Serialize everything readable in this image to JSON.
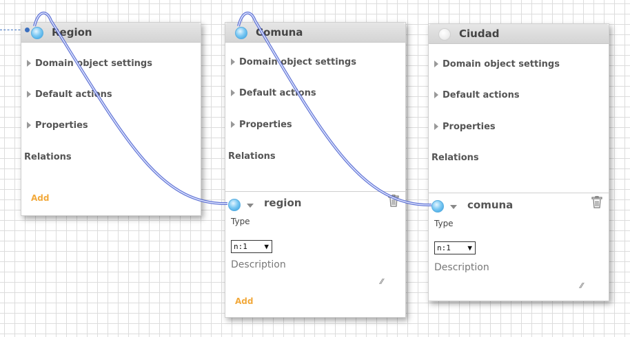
{
  "entities": [
    {
      "title": "Region",
      "sections": [
        "Domain object settings",
        "Default actions",
        "Properties"
      ],
      "relations_label": "Relations",
      "add_label": "Add",
      "relation": null
    },
    {
      "title": "Comuna",
      "sections": [
        "Domain object settings",
        "Default actions",
        "Properties"
      ],
      "relations_label": "Relations",
      "relation": {
        "name": "region",
        "type_label": "Type",
        "type_value": "n:1",
        "description_placeholder": "Description",
        "add_label": "Add"
      }
    },
    {
      "title": "Ciudad",
      "sections": [
        "Domain object settings",
        "Default actions",
        "Properties"
      ],
      "relations_label": "Relations",
      "relation": {
        "name": "comuna",
        "type_label": "Type",
        "type_value": "n:1",
        "description_placeholder": "Description"
      }
    }
  ],
  "colors": {
    "grid": "#dcdcdc",
    "connector": "#4a5fcf",
    "add_link": "#f2a93b",
    "orb_active": "#2f9ee0"
  },
  "icons": {
    "relation_connector": "blue-orb-icon",
    "delete": "trash-icon",
    "collapsed": "triangle-right-icon",
    "dropdown": "chevron-down-icon",
    "resize": "resize-handle-icon"
  }
}
